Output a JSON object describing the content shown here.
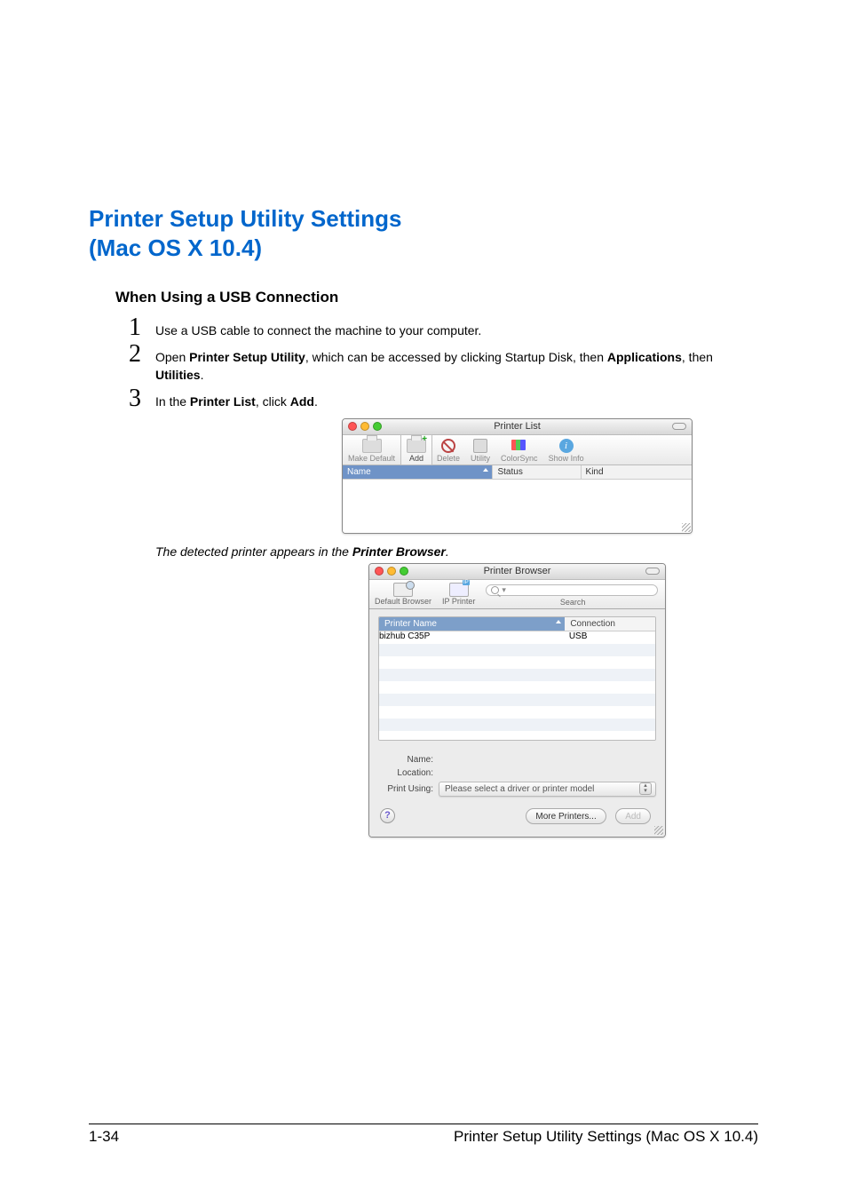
{
  "heading": {
    "line1": "Printer Setup Utility Settings",
    "line2": "(Mac OS X 10.4)"
  },
  "subheading": "When Using a USB Connection",
  "steps": {
    "s1": {
      "num": "1",
      "text": "Use a USB cable to connect the machine to your computer."
    },
    "s2": {
      "num": "2",
      "prefix": "Open ",
      "bold1": "Printer Setup Utility",
      "mid1": ", which can be accessed by clicking Startup Disk, then ",
      "bold2": "Applications",
      "mid2": ", then ",
      "bold3": "Utilities",
      "suffix": "."
    },
    "s3": {
      "num": "3",
      "prefix": "In the ",
      "bold1": "Printer List",
      "mid1": ", click ",
      "bold2": "Add",
      "suffix": "."
    }
  },
  "caption": {
    "prefix": "The detected printer appears in the ",
    "bold": "Printer Browser",
    "suffix": "."
  },
  "printerList": {
    "title": "Printer List",
    "toolbar": {
      "makeDefault": "Make Default",
      "add": "Add",
      "delete": "Delete",
      "utility": "Utility",
      "colorsync": "ColorSync",
      "showInfo": "Show Info"
    },
    "columns": {
      "name": "Name",
      "status": "Status",
      "kind": "Kind"
    }
  },
  "printerBrowser": {
    "title": "Printer Browser",
    "tabs": {
      "defaultBrowser": "Default Browser",
      "ipPrinter": "IP Printer",
      "search": "Search"
    },
    "listColumns": {
      "printerName": "Printer Name",
      "connection": "Connection"
    },
    "row": {
      "name": "bizhub C35P",
      "connection": "USB"
    },
    "form": {
      "nameLabel": "Name:",
      "locationLabel": "Location:",
      "printUsingLabel": "Print Using:",
      "printUsingValue": "Please select a driver or printer model"
    },
    "buttons": {
      "help": "?",
      "morePrinters": "More Printers...",
      "add": "Add"
    },
    "searchPlaceholder": ""
  },
  "footer": {
    "pageNum": "1-34",
    "title": "Printer Setup Utility Settings (Mac OS X 10.4)"
  }
}
